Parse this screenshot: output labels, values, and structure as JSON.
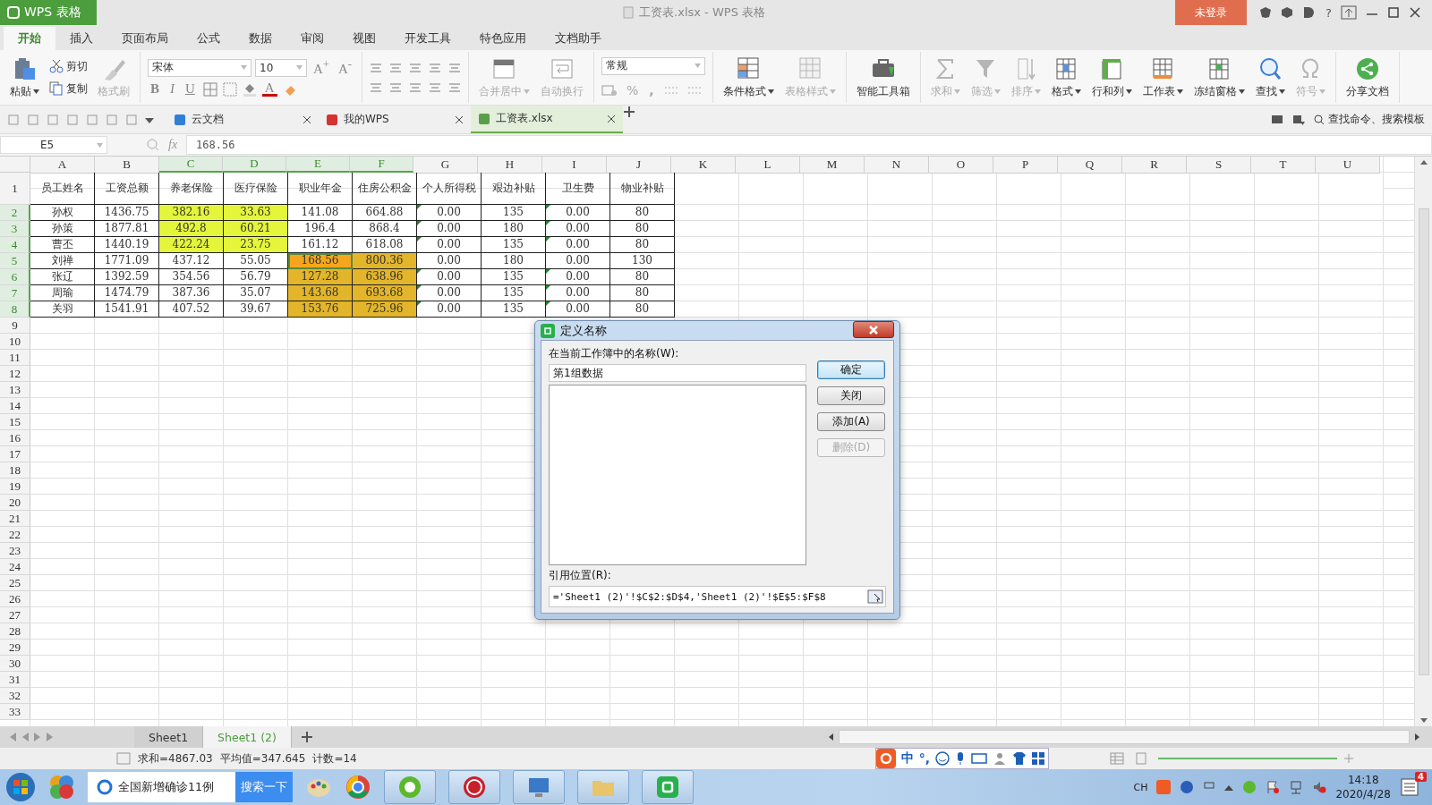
{
  "window": {
    "app_button": "WPS 表格",
    "title": "工资表.xlsx - WPS 表格",
    "login_button": "未登录",
    "help": "?"
  },
  "menu_tabs": [
    {
      "label": "开始",
      "selected": true
    },
    {
      "label": "插入",
      "selected": false
    },
    {
      "label": "页面布局",
      "selected": false
    },
    {
      "label": "公式",
      "selected": false
    },
    {
      "label": "数据",
      "selected": false
    },
    {
      "label": "审阅",
      "selected": false
    },
    {
      "label": "视图",
      "selected": false
    },
    {
      "label": "开发工具",
      "selected": false
    },
    {
      "label": "特色应用",
      "selected": false
    },
    {
      "label": "文档助手",
      "selected": false
    }
  ],
  "ribbon": {
    "paste": "粘贴",
    "cut": "剪切",
    "copy": "复制",
    "format_painter": {
      "label": "格式刷",
      "disabled": true
    },
    "font_name": "宋体",
    "font_size": "10",
    "grow": {
      "letter": "A",
      "sign": "+"
    },
    "shrink": {
      "letter": "A",
      "sign": "-"
    },
    "bold": "B",
    "italic": "I",
    "underline": "U",
    "font_color": "A",
    "merge": {
      "label": "合并居中",
      "disabled": true
    },
    "wrap": {
      "label": "自动换行",
      "disabled": true
    },
    "number_format": "常规",
    "percent": "%",
    "comma": ",",
    "tool_groups": [
      [
        {
          "label": "条件格式",
          "disabled": false,
          "dropdown": true
        },
        {
          "label": "表格样式",
          "disabled": true,
          "dropdown": true
        }
      ],
      [
        {
          "label": "智能工具箱",
          "disabled": false,
          "dropdown": false
        }
      ],
      [
        {
          "label": "求和",
          "disabled": true,
          "dropdown": true
        },
        {
          "label": "筛选",
          "disabled": true,
          "dropdown": true
        },
        {
          "label": "排序",
          "disabled": true,
          "dropdown": true
        },
        {
          "label": "格式",
          "disabled": false,
          "dropdown": true
        },
        {
          "label": "行和列",
          "disabled": false,
          "dropdown": true
        },
        {
          "label": "工作表",
          "disabled": false,
          "dropdown": true
        },
        {
          "label": "冻结窗格",
          "disabled": false,
          "dropdown": true
        },
        {
          "label": "查找",
          "disabled": false,
          "dropdown": true
        },
        {
          "label": "符号",
          "disabled": true,
          "dropdown": true
        }
      ],
      [
        {
          "label": "分享文档",
          "disabled": false,
          "dropdown": false
        }
      ]
    ]
  },
  "doc_tabs": [
    {
      "label": "云文档",
      "selected": false
    },
    {
      "label": "我的WPS",
      "selected": false
    },
    {
      "label": "工资表.xlsx",
      "selected": true
    }
  ],
  "command_search": "查找命令、搜索模板",
  "formula_bar": {
    "cell_ref": "E5",
    "fx": "fx",
    "value": "168.56"
  },
  "sheet": {
    "columns": [
      {
        "label": "A",
        "selected": false
      },
      {
        "label": "B",
        "selected": false
      },
      {
        "label": "C",
        "selected": true
      },
      {
        "label": "D",
        "selected": true
      },
      {
        "label": "E",
        "selected": true
      },
      {
        "label": "F",
        "selected": true
      },
      {
        "label": "G",
        "selected": false
      },
      {
        "label": "H",
        "selected": false
      },
      {
        "label": "I",
        "selected": false
      },
      {
        "label": "J",
        "selected": false
      },
      {
        "label": "K",
        "selected": false
      },
      {
        "label": "L",
        "selected": false
      },
      {
        "label": "M",
        "selected": false
      },
      {
        "label": "N",
        "selected": false
      },
      {
        "label": "O",
        "selected": false
      },
      {
        "label": "P",
        "selected": false
      },
      {
        "label": "Q",
        "selected": false
      },
      {
        "label": "R",
        "selected": false
      },
      {
        "label": "S",
        "selected": false
      },
      {
        "label": "T",
        "selected": false
      },
      {
        "label": "U",
        "selected": false
      }
    ],
    "rows": [
      {
        "header": "1",
        "selected": false,
        "cells": [
          {
            "text": "员工姓名"
          },
          {
            "text": "工资总额"
          },
          {
            "text": "养老保险"
          },
          {
            "text": "医疗保险"
          },
          {
            "text": "职业年金"
          },
          {
            "text": "住房公积金"
          },
          {
            "text": "个人所得税"
          },
          {
            "text": "艰边补贴"
          },
          {
            "text": "卫生费"
          },
          {
            "text": "物业补贴"
          }
        ]
      },
      {
        "header": "2",
        "selected": true,
        "cells": [
          {
            "text": "孙权"
          },
          {
            "text": "1436.75"
          },
          {
            "text": "382.16",
            "color": "#e4f53c"
          },
          {
            "text": "33.63",
            "color": "#e4f53c"
          },
          {
            "text": "141.08"
          },
          {
            "text": "664.88"
          },
          {
            "text": "0.00",
            "flagged": true
          },
          {
            "text": "135"
          },
          {
            "text": "0.00",
            "flagged": true
          },
          {
            "text": "80"
          }
        ]
      },
      {
        "header": "3",
        "selected": true,
        "cells": [
          {
            "text": "孙策"
          },
          {
            "text": "1877.81"
          },
          {
            "text": "492.8",
            "color": "#e4f53c"
          },
          {
            "text": "60.21",
            "color": "#e4f53c"
          },
          {
            "text": "196.4"
          },
          {
            "text": "868.4"
          },
          {
            "text": "0.00",
            "flagged": true
          },
          {
            "text": "180"
          },
          {
            "text": "0.00",
            "flagged": true
          },
          {
            "text": "80"
          }
        ]
      },
      {
        "header": "4",
        "selected": true,
        "cells": [
          {
            "text": "曹丕"
          },
          {
            "text": "1440.19"
          },
          {
            "text": "422.24",
            "color": "#e4f53c"
          },
          {
            "text": "23.75",
            "color": "#e4f53c"
          },
          {
            "text": "161.12"
          },
          {
            "text": "618.08"
          },
          {
            "text": "0.00",
            "flagged": true
          },
          {
            "text": "135"
          },
          {
            "text": "0.00",
            "flagged": true
          },
          {
            "text": "80"
          }
        ]
      },
      {
        "header": "5",
        "selected": true,
        "cells": [
          {
            "text": "刘禅"
          },
          {
            "text": "1771.09"
          },
          {
            "text": "437.12"
          },
          {
            "text": "55.05"
          },
          {
            "text": "168.56",
            "color": "#f5a61e",
            "active": true
          },
          {
            "text": "800.36",
            "color": "#e2b52a"
          },
          {
            "text": "0.00",
            "flagged": false
          },
          {
            "text": "180"
          },
          {
            "text": "0.00",
            "flagged": false
          },
          {
            "text": "130"
          }
        ]
      },
      {
        "header": "6",
        "selected": true,
        "cells": [
          {
            "text": "张辽"
          },
          {
            "text": "1392.59"
          },
          {
            "text": "354.56"
          },
          {
            "text": "56.79"
          },
          {
            "text": "127.28",
            "color": "#e2b52a"
          },
          {
            "text": "638.96",
            "color": "#e2b52a"
          },
          {
            "text": "0.00",
            "flagged": true
          },
          {
            "text": "135"
          },
          {
            "text": "0.00",
            "flagged": true
          },
          {
            "text": "80"
          }
        ]
      },
      {
        "header": "7",
        "selected": true,
        "cells": [
          {
            "text": "周瑜"
          },
          {
            "text": "1474.79"
          },
          {
            "text": "387.36"
          },
          {
            "text": "35.07"
          },
          {
            "text": "143.68",
            "color": "#e2b52a"
          },
          {
            "text": "693.68",
            "color": "#e2b52a"
          },
          {
            "text": "0.00",
            "flagged": true
          },
          {
            "text": "135"
          },
          {
            "text": "0.00",
            "flagged": true
          },
          {
            "text": "80"
          }
        ]
      },
      {
        "header": "8",
        "selected": true,
        "cells": [
          {
            "text": "关羽"
          },
          {
            "text": "1541.91"
          },
          {
            "text": "407.52"
          },
          {
            "text": "39.67"
          },
          {
            "text": "153.76",
            "color": "#e2b52a"
          },
          {
            "text": "725.96",
            "color": "#e2b52a"
          },
          {
            "text": "0.00",
            "flagged": true
          },
          {
            "text": "135"
          },
          {
            "text": "0.00",
            "flagged": true
          },
          {
            "text": "80"
          }
        ]
      }
    ],
    "empty_rows": [
      "9",
      "10",
      "11",
      "12",
      "13",
      "14",
      "15",
      "16",
      "17",
      "18",
      "19",
      "20",
      "21",
      "22",
      "23",
      "24",
      "25",
      "26",
      "27",
      "28",
      "29",
      "30",
      "31",
      "32",
      "33"
    ]
  },
  "dialog": {
    "title": "定义名称",
    "name_label": "在当前工作簿中的名称(W):",
    "name_value": "第1组数据",
    "ref_label": "引用位置(R):",
    "ref_value": "='Sheet1 (2)'!$C$2:$D$4,'Sheet1 (2)'!$E$5:$F$8",
    "buttons": [
      {
        "label": "确定",
        "default": true,
        "disabled": false
      },
      {
        "label": "关闭",
        "default": false,
        "disabled": false
      },
      {
        "label": "添加(A)",
        "default": false,
        "disabled": false
      },
      {
        "label": "删除(D)",
        "default": false,
        "disabled": true
      }
    ]
  },
  "sheet_tabs": [
    {
      "label": "Sheet1",
      "selected": false
    },
    {
      "label": "Sheet1 (2)",
      "selected": true
    }
  ],
  "status_bar": [
    "求和=4867.03",
    "平均值=347.645",
    "计数=14"
  ],
  "ime": {
    "lang": "中",
    "punct": "°,"
  },
  "taskbar": {
    "search_text": "全国新增确诊11例",
    "search_button": "搜索一下",
    "tray_lang": "CH",
    "time": "14:18",
    "date": "2020/4/28",
    "notification_count": "4"
  }
}
